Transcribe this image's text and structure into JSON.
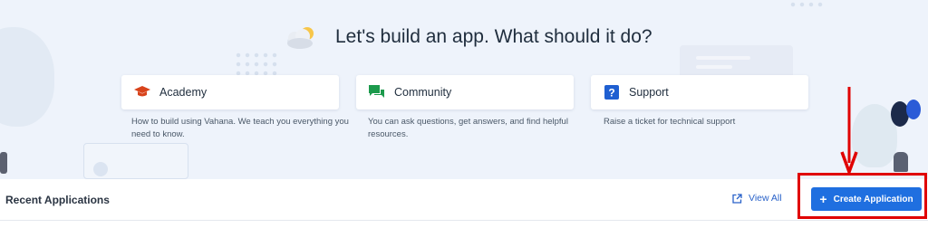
{
  "hero": {
    "title": "Let's build an app. What should it do?",
    "icon": "cloud-sun-icon"
  },
  "cards": [
    {
      "label": "Academy",
      "description": "How to build using Vahana. We teach you everything you need to know.",
      "icon": "graduation-cap-icon",
      "icon_color": "#d8431b"
    },
    {
      "label": "Community",
      "description": "You can ask questions, get answers, and find helpful resources.",
      "icon": "chat-bubbles-icon",
      "icon_color": "#1c9a4c"
    },
    {
      "label": "Support",
      "description": "Raise a ticket for technical support",
      "icon": "question-square-icon",
      "icon_color": "#1f5fd1"
    }
  ],
  "recent": {
    "title": "Recent Applications",
    "view_all_label": "View All",
    "view_all_icon": "external-link-icon",
    "create_label": "Create Application",
    "create_icon": "plus-icon"
  },
  "colors": {
    "accent": "#1f6fe0",
    "link": "#2962c9",
    "annotation": "#e00000"
  }
}
